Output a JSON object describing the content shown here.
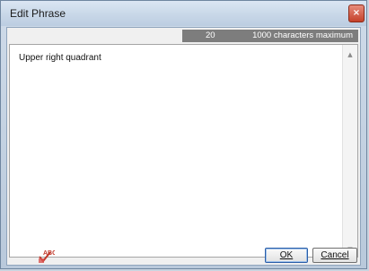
{
  "window": {
    "title": "Edit Phrase",
    "close_glyph": "×"
  },
  "counter": {
    "count": "20",
    "max_label": "1000 characters maximum",
    "bg_color": "#7d7d7d"
  },
  "editor": {
    "text": "Upper right quadrant"
  },
  "scrollbar": {
    "up_glyph": "▲",
    "down_glyph": "▼"
  },
  "buttons": {
    "spell_icon": "spell-check-icon",
    "ok_label": "OK",
    "cancel_label": "Cancel"
  }
}
